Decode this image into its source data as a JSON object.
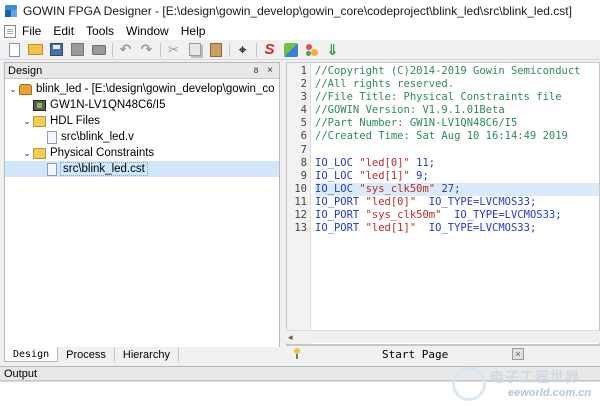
{
  "window": {
    "title": "GOWIN FPGA Designer - [E:\\design\\gowin_develop\\gowin_core\\codeproject\\blink_led\\src\\blink_led.cst]"
  },
  "menu": {
    "items": [
      "File",
      "Edit",
      "Tools",
      "Window",
      "Help"
    ]
  },
  "toolbar": {
    "icons": [
      "new-file-icon",
      "open-folder-icon",
      "save-icon",
      "save-all-icon",
      "print-icon",
      "undo-icon",
      "redo-icon",
      "cut-icon",
      "copy-icon",
      "paste-icon",
      "find-icon",
      "synthesize-icon",
      "place-route-icon",
      "program-device-icon",
      "download-icon"
    ]
  },
  "design_panel": {
    "title": "Design",
    "float_glyph": "ᴕ",
    "close_glyph": "×",
    "tree": [
      {
        "label": "blink_led - [E:\\design\\gowin_develop\\gowin_co",
        "icon": "project-icon",
        "level": 0,
        "expanded": true
      },
      {
        "label": "GW1N-LV1QN48C6/I5",
        "icon": "chip-icon",
        "level": 1
      },
      {
        "label": "HDL Files",
        "icon": "folder-icon",
        "level": 1,
        "expanded": true
      },
      {
        "label": "src\\blink_led.v",
        "icon": "file-icon",
        "level": 2
      },
      {
        "label": "Physical Constraints",
        "icon": "folder-icon",
        "level": 1,
        "expanded": true
      },
      {
        "label": "src\\blink_led.cst",
        "icon": "file-icon",
        "level": 2,
        "selected": true
      }
    ]
  },
  "bottom_tabs": [
    "Design",
    "Process",
    "Hierarchy"
  ],
  "editor": {
    "line_numbers": [
      "1",
      "2",
      "3",
      "4",
      "5",
      "6",
      "7",
      "8",
      "9",
      "10",
      "11",
      "12",
      "13"
    ],
    "current_line": 10,
    "lines": [
      [
        {
          "t": "//Copyright (C)2014-2019 Gowin Semiconduct",
          "c": "comment"
        }
      ],
      [
        {
          "t": "//All rights reserved.",
          "c": "comment"
        }
      ],
      [
        {
          "t": "//File Title: Physical Constraints file",
          "c": "comment"
        }
      ],
      [
        {
          "t": "//GOWIN Version: V1.9.1.01Beta",
          "c": "comment"
        }
      ],
      [
        {
          "t": "//Part Number: GW1N-LV1QN48C6/I5",
          "c": "comment"
        }
      ],
      [
        {
          "t": "//Created Time: Sat Aug 10 16:14:49 2019",
          "c": "comment"
        }
      ],
      [],
      [
        {
          "t": "IO_LOC ",
          "c": "kw"
        },
        {
          "t": "\"led[0]\"",
          "c": "str"
        },
        {
          "t": " 11;",
          "c": "num"
        }
      ],
      [
        {
          "t": "IO_LOC ",
          "c": "kw"
        },
        {
          "t": "\"led[1]\"",
          "c": "str"
        },
        {
          "t": " 9;",
          "c": "num"
        }
      ],
      [
        {
          "t": "IO_LOC ",
          "c": "kw"
        },
        {
          "t": "\"sys_clk50m\"",
          "c": "str"
        },
        {
          "t": " 27;",
          "c": "num"
        }
      ],
      [
        {
          "t": "IO_PORT ",
          "c": "kw"
        },
        {
          "t": "\"led[0]\"",
          "c": "str"
        },
        {
          "t": "  IO_TYPE=LVCMOS33;",
          "c": "kw"
        }
      ],
      [
        {
          "t": "IO_PORT ",
          "c": "kw"
        },
        {
          "t": "\"sys_clk50m\"",
          "c": "str"
        },
        {
          "t": "  IO_TYPE=LVCMOS33;",
          "c": "kw"
        }
      ],
      [
        {
          "t": "IO_PORT ",
          "c": "kw"
        },
        {
          "t": "\"led[1]\"",
          "c": "str"
        },
        {
          "t": "  IO_TYPE=LVCMOS33;",
          "c": "kw"
        }
      ]
    ]
  },
  "start_tab": {
    "label": "Start Page",
    "close_glyph": "×"
  },
  "output_panel": {
    "title": "Output"
  },
  "watermark": {
    "brand": "电子工程世界",
    "url": "eeworld.com.cn"
  },
  "colors": {
    "comment": "#2e8b57",
    "keyword": "#1f3ad0",
    "string": "#b52a2a",
    "current_line": "#dbeaf8",
    "selection": "#cfe6fb"
  }
}
